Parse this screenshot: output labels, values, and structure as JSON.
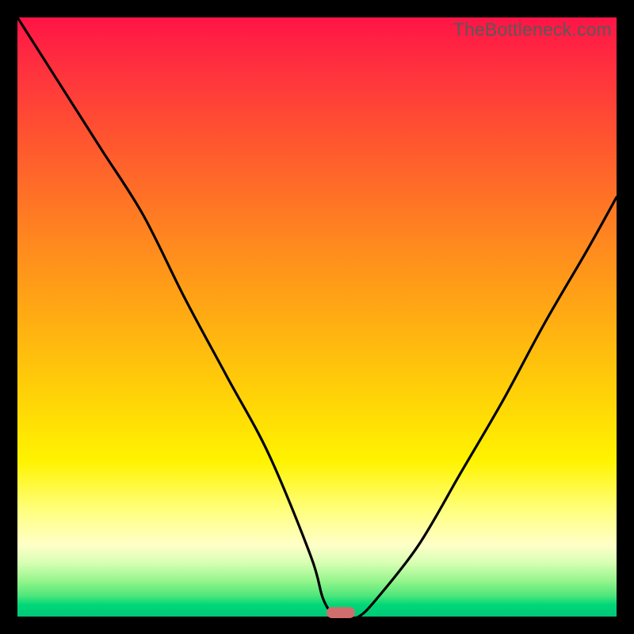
{
  "watermark": "TheBottleneck.com",
  "colors": {
    "frame": "#000000",
    "gradient_top": "#FF1446",
    "gradient_bottom": "#00C777",
    "curve": "#000000",
    "marker": "#CF6E6C",
    "watermark_text": "#595959"
  },
  "chart_data": {
    "type": "line",
    "title": "",
    "xlabel": "",
    "ylabel": "",
    "xlim": [
      0,
      100
    ],
    "ylim": [
      0,
      100
    ],
    "legend": false,
    "grid": false,
    "series": [
      {
        "name": "bottleneck-curve",
        "x": [
          0,
          7,
          14,
          21,
          28,
          35,
          42,
          49,
          51,
          53,
          55,
          57,
          60,
          67,
          74,
          81,
          88,
          95,
          100
        ],
        "values": [
          100,
          89,
          78,
          67,
          53,
          40,
          27,
          10,
          3,
          0,
          0,
          0,
          3,
          12,
          24,
          36,
          49,
          61,
          70
        ]
      }
    ],
    "annotations": [
      {
        "name": "optimal-marker",
        "x": 54,
        "y": 0,
        "shape": "rounded-rect",
        "color": "#CF6E6C"
      }
    ],
    "background": "vertical-gradient red→yellow→green"
  }
}
